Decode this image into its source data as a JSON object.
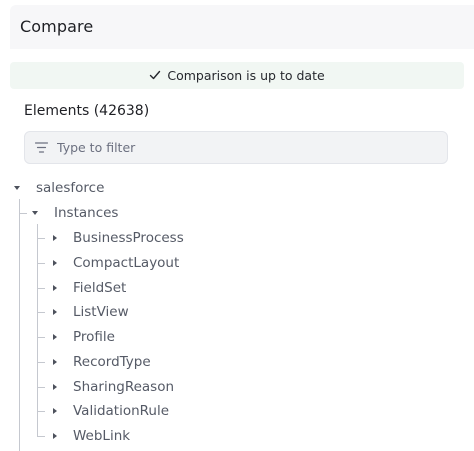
{
  "header": {
    "title": "Compare"
  },
  "status": {
    "text": "Comparison is up to date",
    "icon": "check-icon"
  },
  "elements": {
    "title": "Elements (42638)"
  },
  "filter": {
    "placeholder": "Type to filter",
    "icon": "filter-lines-icon"
  },
  "tree": {
    "root": {
      "label": "salesforce",
      "expanded": true
    },
    "instances": {
      "label": "Instances",
      "expanded": true
    },
    "children": [
      {
        "label": "BusinessProcess"
      },
      {
        "label": "CompactLayout"
      },
      {
        "label": "FieldSet"
      },
      {
        "label": "ListView"
      },
      {
        "label": "Profile"
      },
      {
        "label": "RecordType"
      },
      {
        "label": "SharingReason"
      },
      {
        "label": "ValidationRule"
      },
      {
        "label": "WebLink"
      }
    ]
  },
  "colors": {
    "header_bg": "#f7f7f9",
    "status_bg": "#f1f7f3",
    "filter_bg": "#f2f3f5",
    "tree_text": "#555a66",
    "guide_line": "#c5c8cf"
  }
}
